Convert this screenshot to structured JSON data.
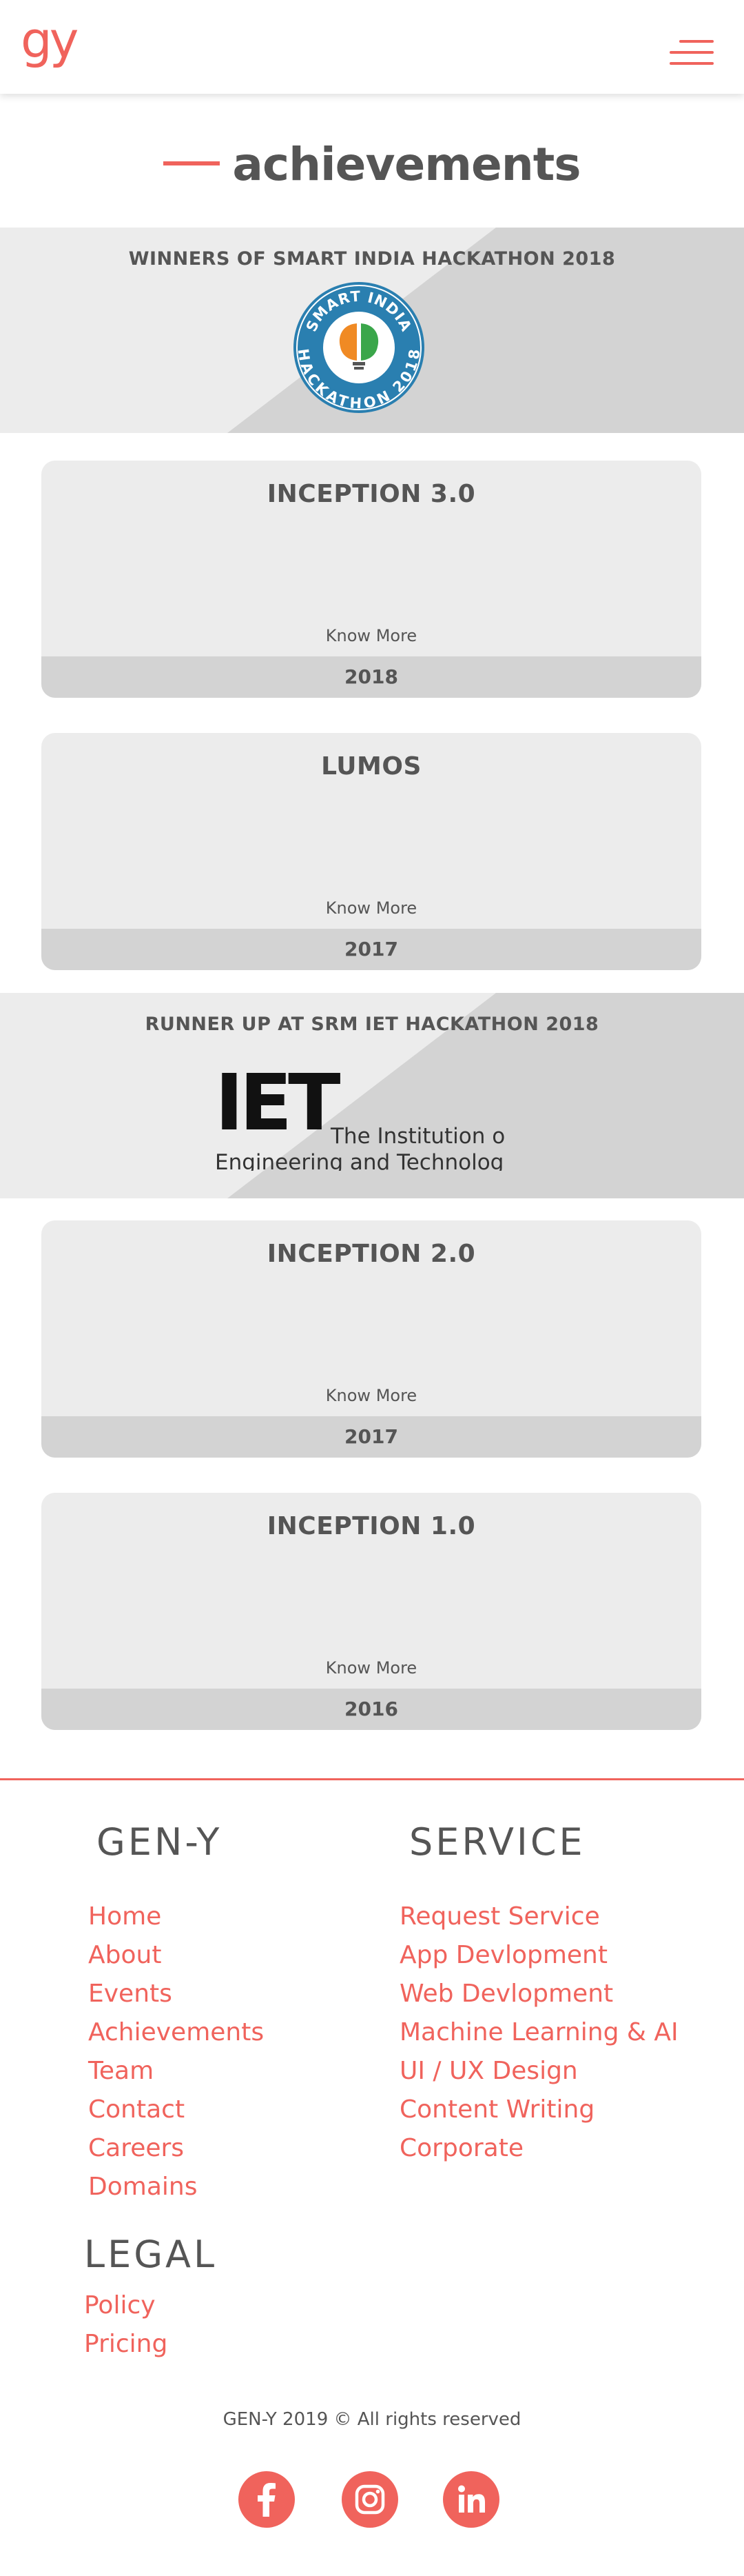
{
  "header": {
    "logo_text": "gy",
    "menu_icon": "hamburger-menu-icon",
    "accent_color": "#f0635c"
  },
  "page": {
    "title": "achievements"
  },
  "banners": [
    {
      "title": "WINNERS OF SMART INDIA HACKATHON 2018",
      "logo_text_top": "SMART INDIA",
      "logo_text_bottom": "HACKATHON 2018"
    },
    {
      "title": "RUNNER UP AT SRM IET HACKATHON 2018",
      "logo_mark": "IET",
      "logo_line1": "The Institution of",
      "logo_line2": "Engineering and Technology"
    }
  ],
  "cards": [
    {
      "title": "INCEPTION 3.0",
      "link": "Know More",
      "year": "2018"
    },
    {
      "title": "LUMOS",
      "link": "Know More",
      "year": "2017"
    },
    {
      "title": "INCEPTION 2.0",
      "link": "Know More",
      "year": "2017"
    },
    {
      "title": "INCEPTION 1.0",
      "link": "Know More",
      "year": "2016"
    }
  ],
  "footer": {
    "geny_heading": "GEN-Y",
    "geny_links": [
      "Home",
      "About",
      "Events",
      "Achievements",
      "Team",
      "Contact",
      "Careers",
      "Domains"
    ],
    "service_heading": "SERVICE",
    "service_links": [
      "Request Service",
      "App Devlopment",
      "Web Devlopment",
      "Machine Learning & AI",
      "UI / UX Design",
      "Content Writing",
      "Corporate"
    ],
    "legal_heading": "LEGAL",
    "legal_links": [
      "Policy",
      "Pricing"
    ],
    "copyright": "GEN-Y 2019 © All rights reserved",
    "social_icons": [
      "facebook-icon",
      "instagram-icon",
      "linkedin-icon"
    ]
  }
}
